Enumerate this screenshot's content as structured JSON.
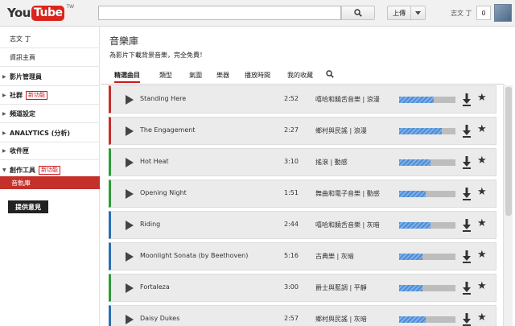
{
  "header": {
    "logo_you": "You",
    "logo_tube": "Tube",
    "logo_region": "TW",
    "search_value": "",
    "upload_label": "上傳",
    "user_name": "志文 丁",
    "notif_count": "0"
  },
  "sidebar": {
    "items": [
      {
        "label": "志文 丁"
      },
      {
        "label": "資訊主頁"
      },
      {
        "label": "影片管理員"
      },
      {
        "label": "社群",
        "badge": "新功能"
      },
      {
        "label": "頻道設定"
      },
      {
        "label": "ANALYTICS (分析)"
      },
      {
        "label": "收件匣"
      },
      {
        "label": "創作工具",
        "badge": "新功能"
      }
    ],
    "active_item": "音軌庫",
    "feedback_label": "提供意見"
  },
  "main": {
    "title": "音樂庫",
    "subtitle": "為影片下載背景音樂，完全免費！",
    "tabs": [
      {
        "label": "精選曲目",
        "active": true
      },
      {
        "label": "類型"
      },
      {
        "label": "氣圍"
      },
      {
        "label": "樂器"
      },
      {
        "label": "播放時間"
      },
      {
        "label": "我的收藏"
      }
    ]
  },
  "tracks": [
    {
      "title": "Standing Here",
      "duration": "2:52",
      "genre": "嘻哈和饒舌音樂 | 浪漫",
      "accent": "#c4302b",
      "popularity": 0.62
    },
    {
      "title": "The Engagement",
      "duration": "2:27",
      "genre": "鄉村與民謠 | 浪漫",
      "accent": "#c4302b",
      "popularity": 0.75
    },
    {
      "title": "Hot Heat",
      "duration": "3:10",
      "genre": "搖滾 | 動感",
      "accent": "#2e9b3a",
      "popularity": 0.55
    },
    {
      "title": "Opening Night",
      "duration": "1:51",
      "genre": "舞曲和電子音樂 | 動感",
      "accent": "#2e9b3a",
      "popularity": 0.47
    },
    {
      "title": "Riding",
      "duration": "2:44",
      "genre": "嘻哈和饒舌音樂 | 灰暗",
      "accent": "#2a6fb3",
      "popularity": 0.55
    },
    {
      "title": "Moonlight Sonata (by Beethoven)",
      "duration": "5:16",
      "genre": "古典樂 | 灰暗",
      "accent": "#2a6fb3",
      "popularity": 0.42
    },
    {
      "title": "Fortaleza",
      "duration": "3:00",
      "genre": "爵士與藍調 | 平靜",
      "accent": "#2e9b3a",
      "popularity": 0.42
    },
    {
      "title": "Daisy Dukes",
      "duration": "2:57",
      "genre": "鄉村與民謠 | 灰暗",
      "accent": "#2a6fb3",
      "popularity": 0.47
    }
  ]
}
